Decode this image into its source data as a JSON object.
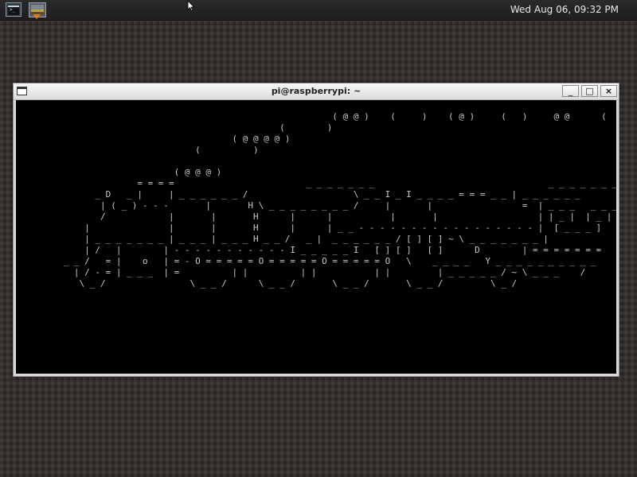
{
  "panel": {
    "clock": "Wed Aug 06, 09:32 PM",
    "launchers": [
      {
        "icon": "terminal-launcher-icon"
      },
      {
        "icon": "image-viewer-task-icon"
      }
    ],
    "indicator_color": "#e07a1f"
  },
  "window": {
    "title": "pi@raspberrypi: ~",
    "buttons": {
      "minimize": "_",
      "maximize": "□",
      "close": "×"
    }
  },
  "terminal": {
    "lines": [
      "",
      "                                                            ( @ @ )    (     )    ( @ )     (   )     @ @      (",
      "                                                  (        )",
      "                                         ( @ @ @ @ )",
      "                                  (          )",
      "",
      "                              ( @ @ @ )",
      "                       = = = =                         _ _ _ _ _ _ _                                 _ _ _ _ _ _ _",
      "               _ D   _ |     | _ _ _ _ _ _ /                    \\ _ _ I _ I _ _ _ _ = = = _ _ | _ _ _ _ _ _",
      "                | ( _ ) - - -       |       H \\ _ _ _ _ _ _ _ _ /     |       |                 =  | _ _ _   _ _ _",
      "                /            |       |       H      |      |           |       |                   | | _ |  | _ |",
      "             |               |       |       H      |      | _ _ - - - - - - - - - - - - - - - - - |  [ _ _ _ ]",
      "             | _ _ _ _ _ _ _ | _ _ _ | _ _ _ H _ _ /   _ |  _ _ _ _ _ _ / [ ] [ ] ~ \\ _ _ _ _ _ _ _ |",
      "             | /   |        | - - - - - - - - - - - I _ _ _ _ _ I   [ ] [ ]   [ ]      D        | = = = = = = =",
      "         _ _ /   = |    o   | = - O = = = = = O = = = = = O = = = = = O   \\    _ _ _ _   Y _ _ _ _ _ _ _ _ _ _",
      "           | / - = | _ _ _  | =          | |          | |           | |         | _ _ _ _ _ / ~ \\ _ _ _    /",
      "            \\ _ /                \\ _ _ /      \\ _ _ /       \\ _ _ /       \\ _ _ /         \\ _ /"
    ]
  }
}
